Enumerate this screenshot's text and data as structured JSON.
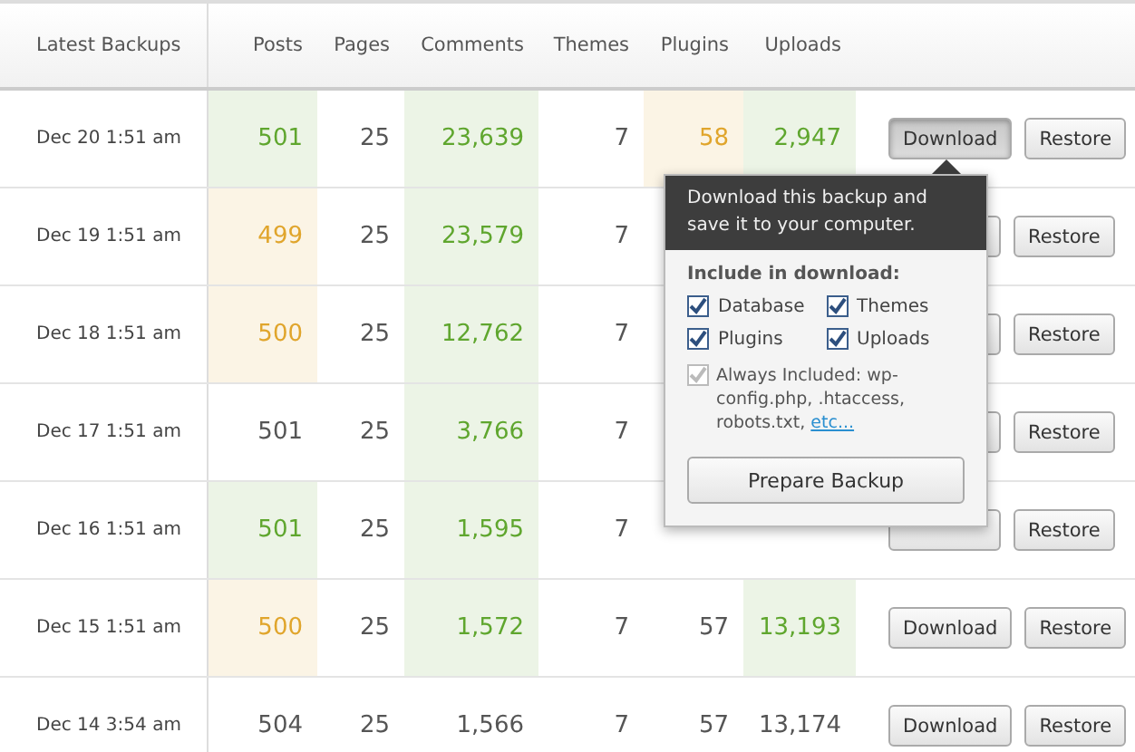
{
  "columns": [
    "Latest Backups",
    "Posts",
    "Pages",
    "Comments",
    "Themes",
    "Plugins",
    "Uploads"
  ],
  "rows": [
    {
      "date": "Dec 20 1:51 am",
      "cells": [
        {
          "value": "501",
          "color": "#5fa62e"
        },
        {
          "value": "25",
          "color": "#555555"
        },
        {
          "value": "23,639",
          "color": "#5fa62e"
        },
        {
          "value": "7",
          "color": "#555555"
        },
        {
          "value": "58",
          "color": "#e0a52c"
        },
        {
          "value": "2,947",
          "color": "#5fa62e"
        }
      ],
      "download": {
        "label": "Download",
        "pressed": true
      },
      "restore": "Restore"
    },
    {
      "date": "Dec 19 1:51 am",
      "cells": [
        {
          "value": "499",
          "color": "#e0a52c"
        },
        {
          "value": "25",
          "color": "#555555"
        },
        {
          "value": "23,579",
          "color": "#5fa62e"
        },
        {
          "value": "7",
          "color": "#555555"
        }
      ],
      "restore": "Restore"
    },
    {
      "date": "Dec 18 1:51 am",
      "cells": [
        {
          "value": "500",
          "color": "#e0a52c"
        },
        {
          "value": "25",
          "color": "#555555"
        },
        {
          "value": "12,762",
          "color": "#5fa62e"
        },
        {
          "value": "7",
          "color": "#555555"
        }
      ],
      "restore": "Restore"
    },
    {
      "date": "Dec 17 1:51 am",
      "cells": [
        {
          "value": "501",
          "color": "#555555"
        },
        {
          "value": "25",
          "color": "#555555"
        },
        {
          "value": "3,766",
          "color": "#5fa62e"
        },
        {
          "value": "7",
          "color": "#555555"
        }
      ],
      "restore": "Restore"
    },
    {
      "date": "Dec 16 1:51 am",
      "cells": [
        {
          "value": "501",
          "color": "#5fa62e"
        },
        {
          "value": "25",
          "color": "#555555"
        },
        {
          "value": "1,595",
          "color": "#5fa62e"
        },
        {
          "value": "7",
          "color": "#555555"
        }
      ],
      "restore": "Restore"
    },
    {
      "date": "Dec 15 1:51 am",
      "cells": [
        {
          "value": "500",
          "color": "#e0a52c"
        },
        {
          "value": "25",
          "color": "#555555"
        },
        {
          "value": "1,572",
          "color": "#5fa62e"
        },
        {
          "value": "7",
          "color": "#555555"
        },
        {
          "value": "57",
          "color": "#555555"
        },
        {
          "value": "13,193",
          "color": "#5fa62e"
        }
      ],
      "download": {
        "label": "Download",
        "pressed": false
      },
      "restore": "Restore"
    },
    {
      "date": "Dec 14 3:54 am",
      "cells": [
        {
          "value": "504",
          "color": "#555555"
        },
        {
          "value": "25",
          "color": "#555555"
        },
        {
          "value": "1,566",
          "color": "#555555"
        },
        {
          "value": "7",
          "color": "#555555"
        },
        {
          "value": "57",
          "color": "#555555"
        },
        {
          "value": "13,174",
          "color": "#555555"
        }
      ],
      "download": {
        "label": "Download",
        "pressed": false
      },
      "restore": "Restore"
    }
  ],
  "popover": {
    "tooltip": "Download this backup and save it to your computer.",
    "heading": "Include in download:",
    "options": [
      {
        "label": "Database",
        "checked": true
      },
      {
        "label": "Themes",
        "checked": true
      },
      {
        "label": "Plugins",
        "checked": true
      },
      {
        "label": "Uploads",
        "checked": true
      }
    ],
    "always": {
      "checked": true,
      "text": "Always Included: wp-config.php, .htaccess, robots.txt,",
      "link": "etc..."
    },
    "button": "Prepare Backup"
  }
}
